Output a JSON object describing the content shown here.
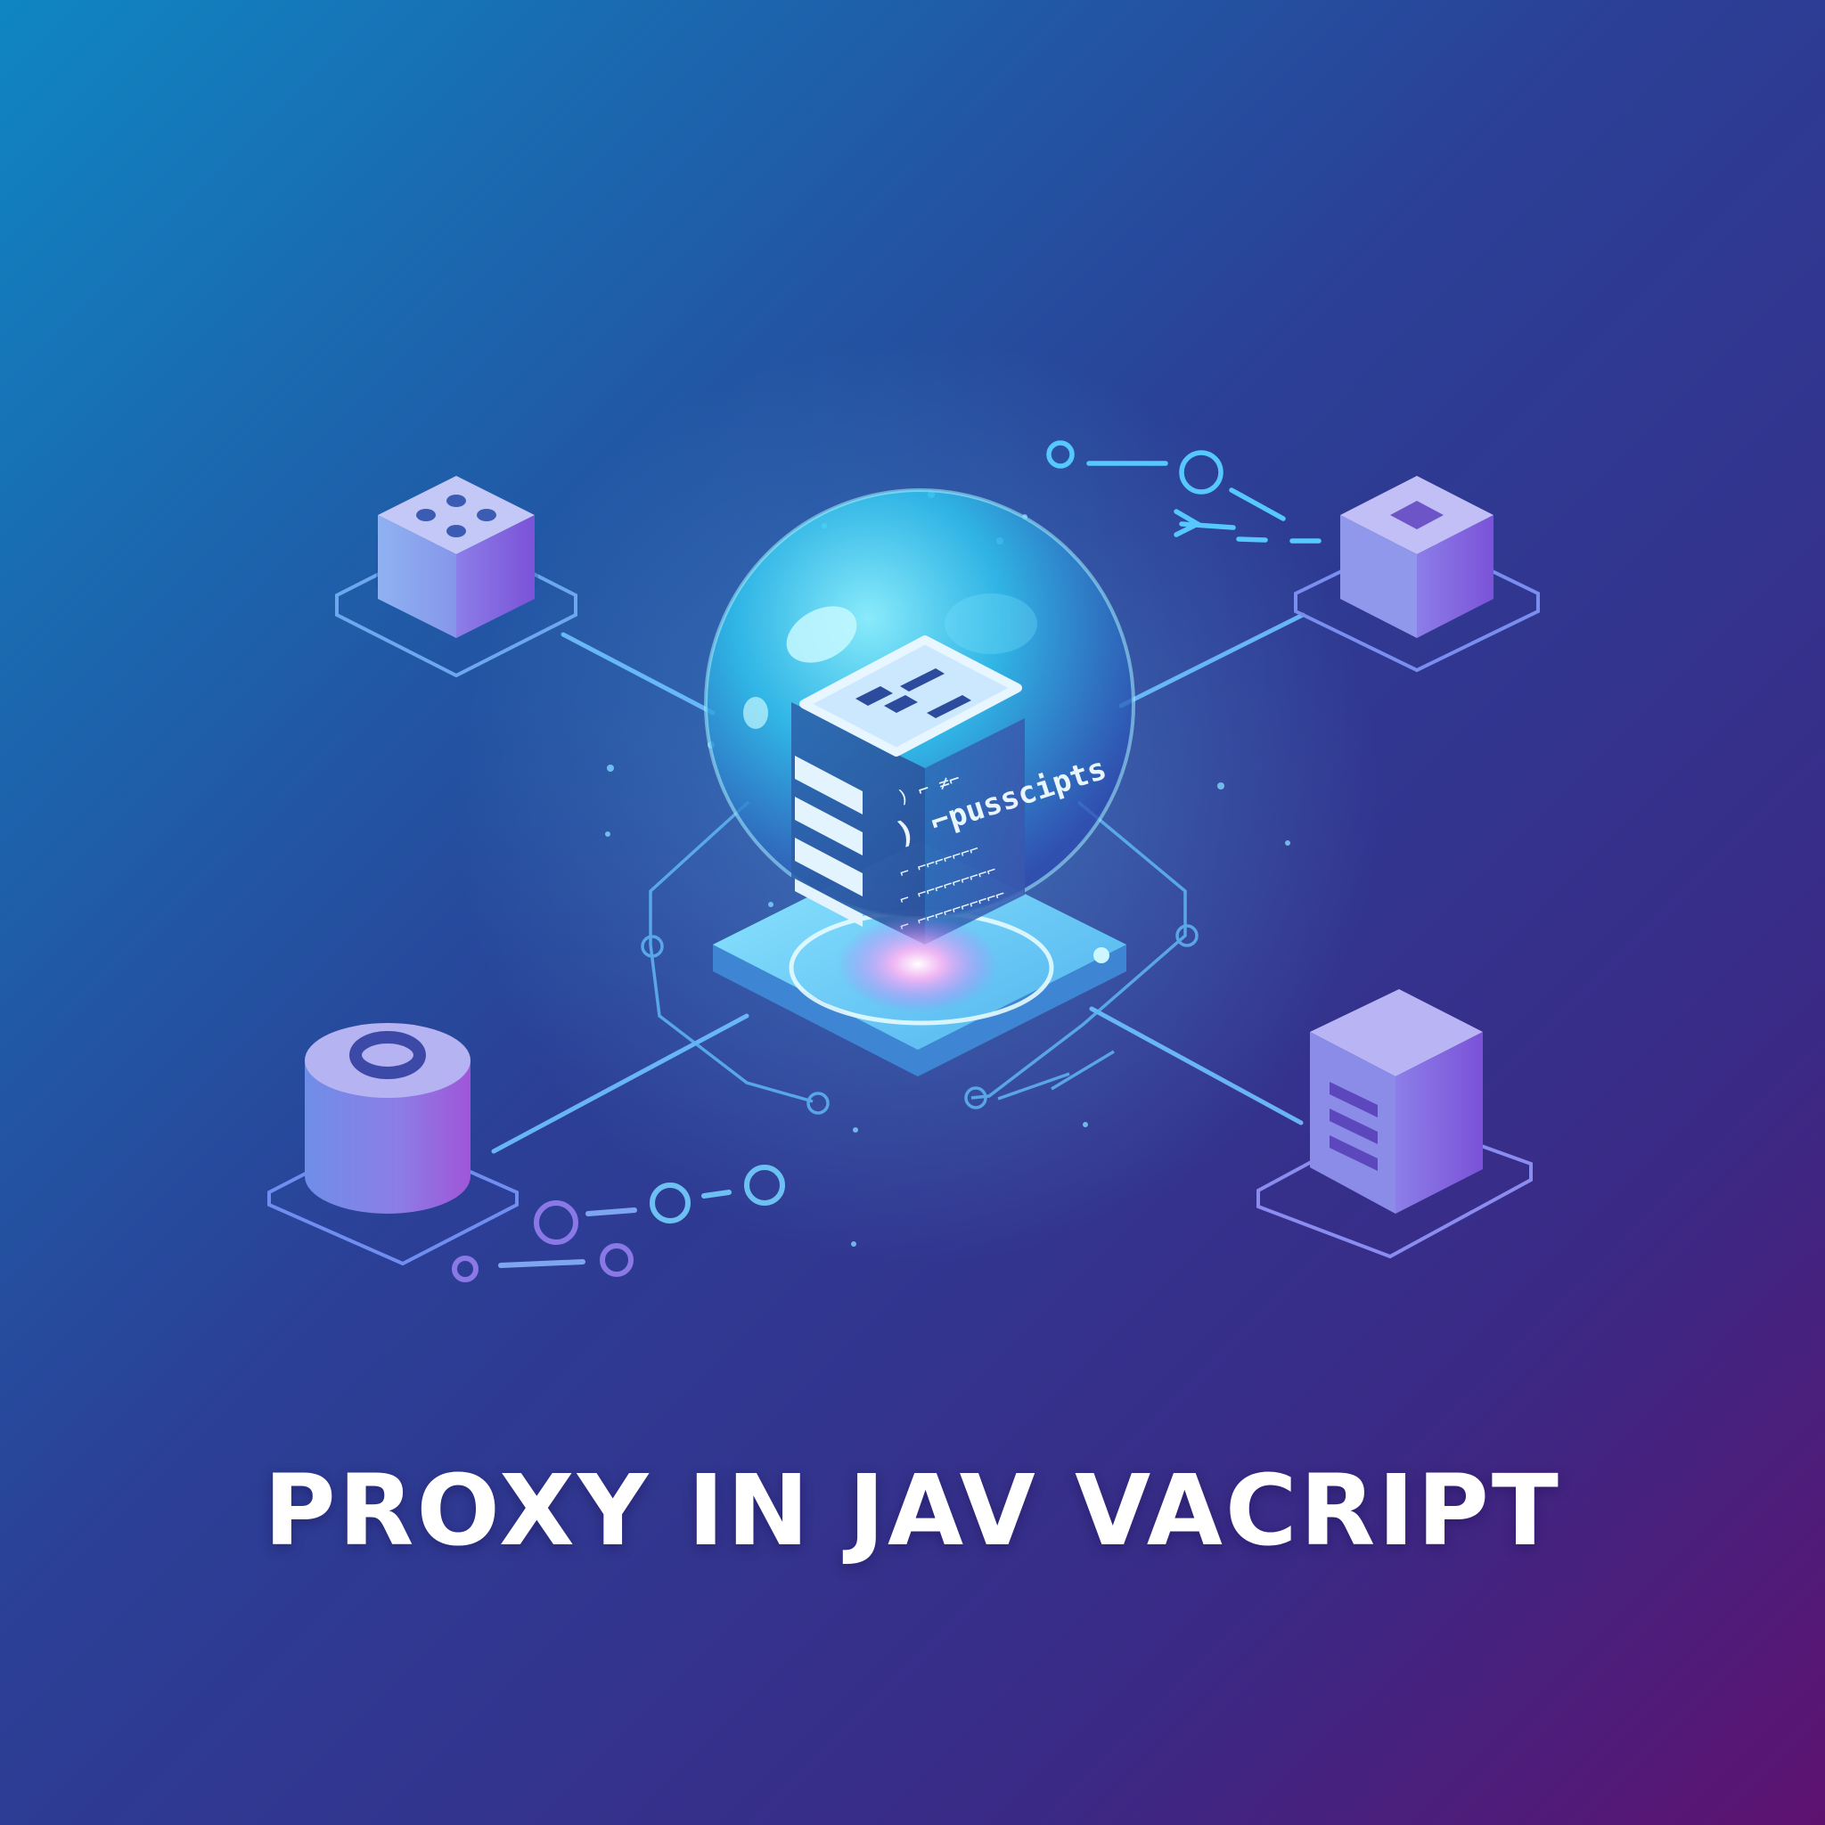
{
  "title": "PROXY IN JAV VACRIPT",
  "proxy_screen_text": [
    ")  ⌐ ≠⌐",
    ") ⌐pusscipts",
    "⌐ ⌐⌐⌐⌐⌐⌐⌐",
    "⌐ ⌐⌐⌐⌐⌐⌐⌐⌐⌐",
    "⌐ ⌐⌐⌐⌐⌐⌐⌐⌐⌐⌐"
  ],
  "colors": {
    "bg_top_left": "#0f86c2",
    "bg_mid": "#2b3f96",
    "bg_bottom_right": "#5e1270",
    "line": "#6fc2ff",
    "node_top": "#c2c6f8",
    "node_left": "#8da6ee",
    "node_right": "#8a64dd",
    "sphere": "#3ad4f6",
    "glow": "#ff9cf0"
  },
  "icons": {
    "center": "proxy-server-sphere-icon",
    "top_left": "dice-cube-icon",
    "top_right": "square-cube-icon",
    "bottom_left": "database-cylinder-icon",
    "bottom_right": "server-tower-icon"
  }
}
